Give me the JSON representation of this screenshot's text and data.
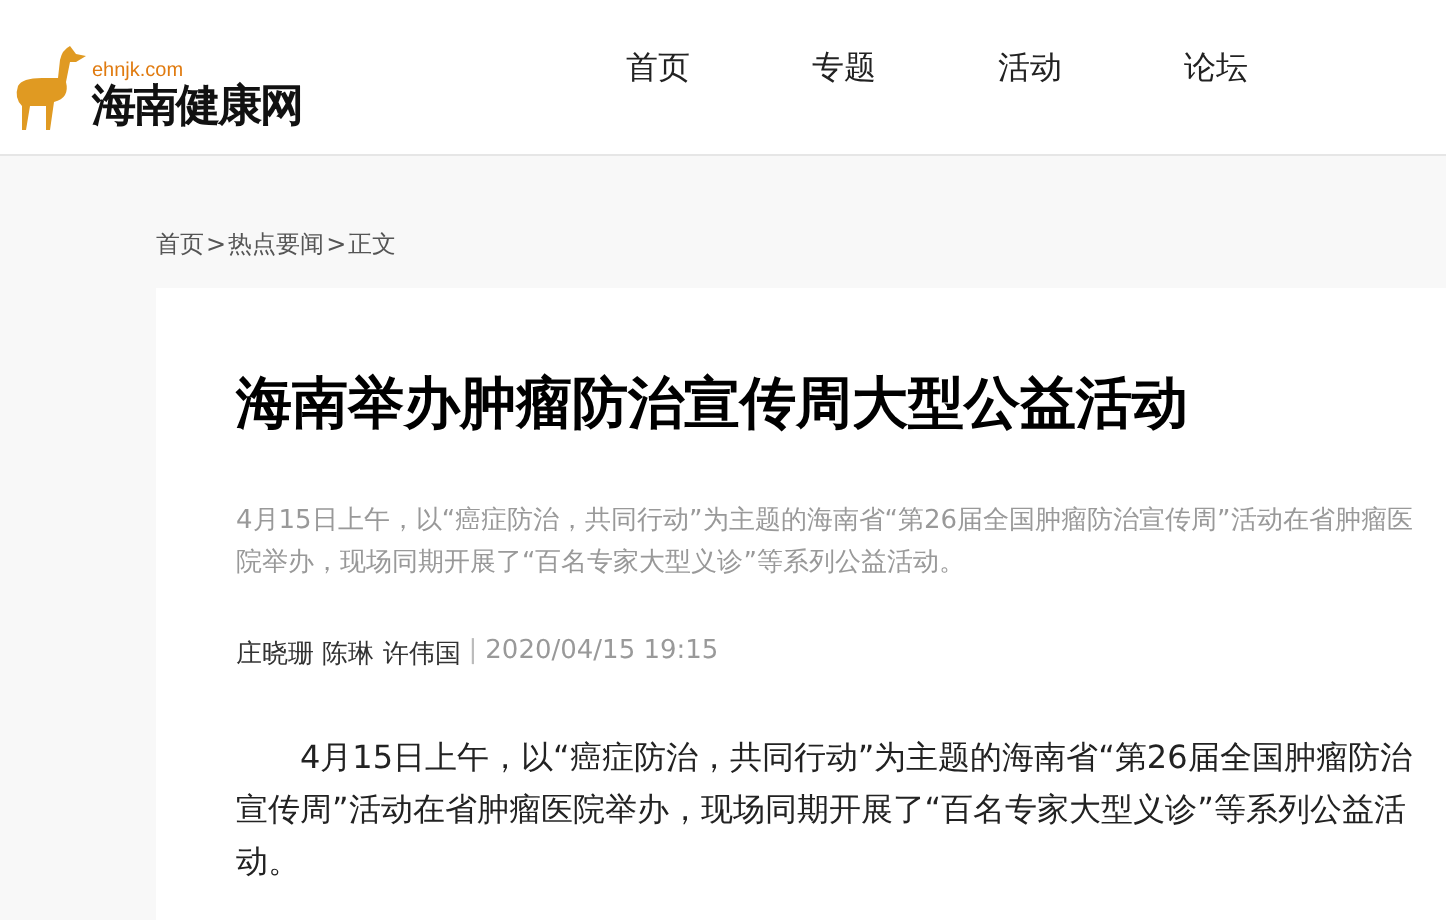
{
  "logo": {
    "domain": "ehnjk.com",
    "name": "海南健康网"
  },
  "nav": [
    {
      "label": "首页"
    },
    {
      "label": "专题"
    },
    {
      "label": "活动"
    },
    {
      "label": "论坛"
    }
  ],
  "breadcrumb": {
    "separator": ">",
    "items": [
      "首页",
      "热点要闻",
      "正文"
    ]
  },
  "article": {
    "title": "海南举办肿瘤防治宣传周大型公益活动",
    "summary": "4月15日上午，以“癌症防治，共同行动”为主题的海南省“第26届全国肿瘤防治宣传周”活动在省肿瘤医院举办，现场同期开展了“百名专家大型义诊”等系列公益活动。",
    "authors": "庄晓珊 陈琳 许伟国",
    "divider": "|",
    "date": "2020/04/15 19:15",
    "paragraphs": [
      "4月15日上午，以“癌症防治，共同行动”为主题的海南省“第26届全国肿瘤防治宣传周”活动在省肿瘤医院举办，现场同期开展了“百名专家大型义诊”等系列公益活动。"
    ]
  }
}
